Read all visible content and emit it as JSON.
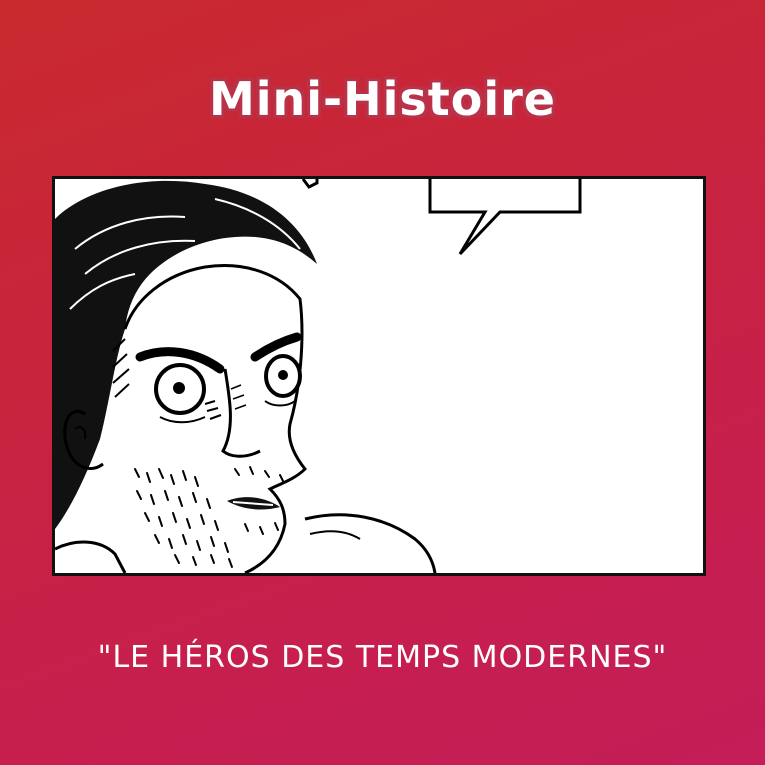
{
  "header": {
    "title": "Mini-Histoire"
  },
  "panel": {
    "illustration": "comic-panel-man-surprised"
  },
  "footer": {
    "subtitle": "\"LE HÉROS DES TEMPS MODERNES\""
  },
  "colors": {
    "background_start": "#c92a2e",
    "background_end": "#c41d58",
    "title_outline": "#b8334a",
    "panel_border": "#111111"
  }
}
